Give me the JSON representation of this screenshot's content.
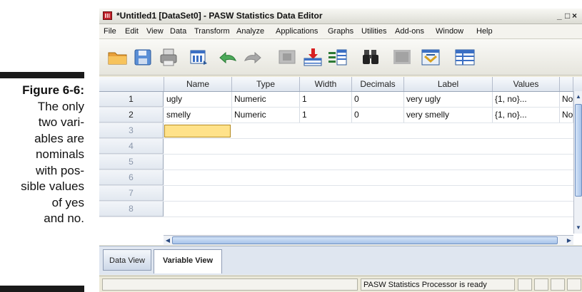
{
  "caption": {
    "title": "Figure 6-6:",
    "lines": [
      "The only",
      "two vari-",
      "ables are",
      "nominals",
      "with pos-",
      "sible values",
      "of yes",
      "and no."
    ]
  },
  "window": {
    "title": "*Untitled1 [DataSet0] - PASW Statistics Data Editor",
    "controls": {
      "minimize": "_",
      "maximize": "□",
      "close": "×"
    }
  },
  "menu": [
    "File",
    "Edit",
    "View",
    "Data",
    "Transform",
    "Analyze",
    "Applications",
    "Graphs",
    "Utilities",
    "Add-ons",
    "Window",
    "Help"
  ],
  "toolbar_icons": [
    "open-folder-icon",
    "save-disk-icon",
    "print-icon",
    "dialog-recall-icon",
    "undo-icon",
    "redo-icon",
    "goto-case-icon",
    "goto-variable-icon",
    "variables-icon",
    "find-binoculars-icon",
    "insert-cases-icon",
    "split-file-icon",
    "weight-cases-icon",
    "value-labels-icon"
  ],
  "grid": {
    "columns": [
      "Name",
      "Type",
      "Width",
      "Decimals",
      "Label",
      "Values",
      ""
    ],
    "rows": [
      {
        "num": "1",
        "cells": [
          "ugly",
          "Numeric",
          "1",
          "0",
          "very ugly",
          "{1, no}...",
          "No"
        ]
      },
      {
        "num": "2",
        "cells": [
          "smelly",
          "Numeric",
          "1",
          "0",
          "very smelly",
          "{1, no}...",
          "No"
        ]
      },
      {
        "num": "3",
        "cells": [
          "",
          "",
          "",
          "",
          "",
          "",
          ""
        ]
      },
      {
        "num": "4",
        "cells": [
          "",
          "",
          "",
          "",
          "",
          "",
          ""
        ]
      },
      {
        "num": "5",
        "cells": [
          "",
          "",
          "",
          "",
          "",
          "",
          ""
        ]
      },
      {
        "num": "6",
        "cells": [
          "",
          "",
          "",
          "",
          "",
          "",
          ""
        ]
      },
      {
        "num": "7",
        "cells": [
          "",
          "",
          "",
          "",
          "",
          "",
          ""
        ]
      },
      {
        "num": "8",
        "cells": [
          "",
          "",
          "",
          "",
          "",
          "",
          ""
        ]
      }
    ]
  },
  "tabs": {
    "data_view": "Data View",
    "variable_view": "Variable View"
  },
  "status": {
    "processor": "PASW Statistics Processor is ready"
  },
  "colors": {
    "selected_cell": "#ffe28a",
    "title_icon": "#c0202a",
    "header_bg": "#dfe6ef"
  }
}
